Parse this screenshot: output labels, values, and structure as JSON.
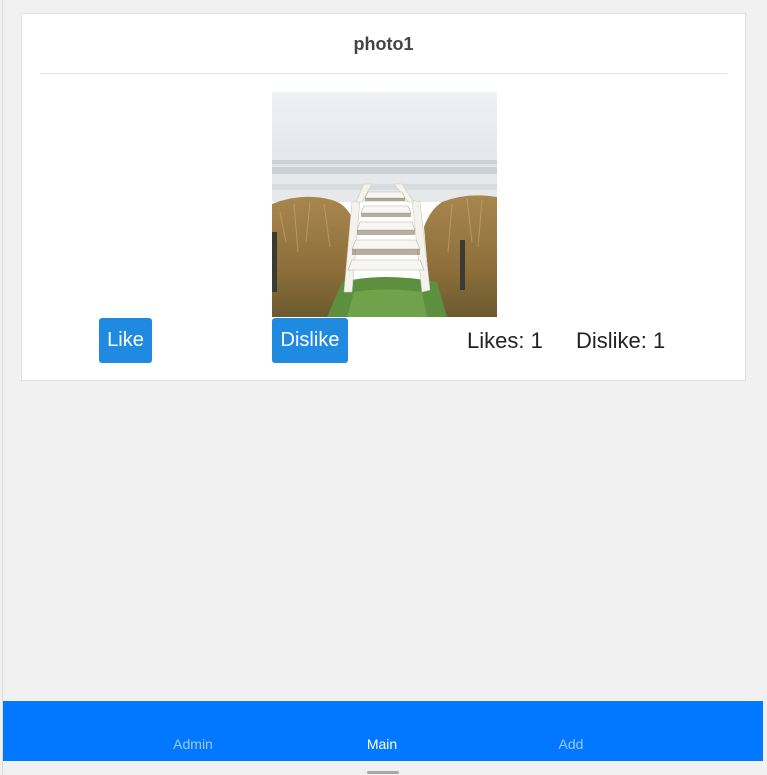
{
  "post": {
    "title": "photo1",
    "image": "beach-boardwalk-stairs-photo",
    "like_label": "Like",
    "dislike_label": "Dislike",
    "likes_text": "Likes: 1",
    "dislikes_text": "Dislike: 1"
  },
  "tabbar": {
    "tabs": [
      {
        "label": "Admin",
        "active": false
      },
      {
        "label": "Main",
        "active": true
      },
      {
        "label": "Add",
        "active": false
      }
    ]
  },
  "colors": {
    "accent": "#2089e0",
    "tabbar": "#0178ff",
    "background": "#f1f1f1"
  }
}
